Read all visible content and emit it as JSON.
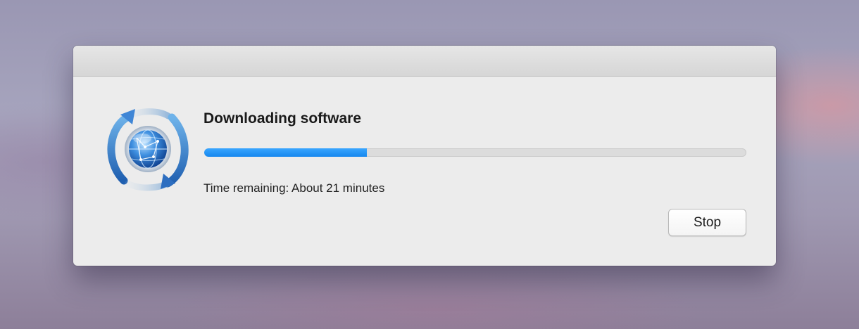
{
  "dialog": {
    "title": "Downloading software",
    "progress_fraction": 0.3,
    "status_text": "Time remaining: About 21 minutes",
    "stop_label": "Stop"
  },
  "icons": {
    "app_icon": "software-update-globe-icon"
  },
  "colors": {
    "progress_fill": "#1a8ff1",
    "progress_track": "#dcdcdc",
    "window_bg": "#ececec"
  }
}
